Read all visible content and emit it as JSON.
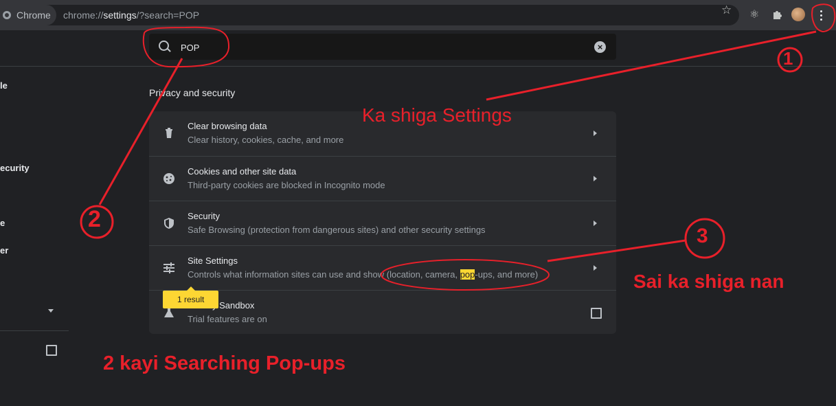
{
  "browser": {
    "tab_label": "Chrome",
    "url_prefix": "chrome://",
    "url_bold": "settings",
    "url_suffix": "/?search=POP"
  },
  "search": {
    "value": "POP",
    "clear_icon": "clear-icon"
  },
  "sidebar": {
    "items": [
      {
        "label": "le"
      },
      {
        "label": "ecurity"
      },
      {
        "label": "e"
      },
      {
        "label": "er"
      }
    ]
  },
  "main": {
    "section_title": "Privacy and security",
    "rows": [
      {
        "icon": "trash-icon",
        "title": "Clear browsing data",
        "subtitle": "Clear history, cookies, cache, and more"
      },
      {
        "icon": "cookie-icon",
        "title": "Cookies and other site data",
        "subtitle": "Third-party cookies are blocked in Incognito mode"
      },
      {
        "icon": "shield-icon",
        "title": "Security",
        "subtitle": "Safe Browsing (protection from dangerous sites) and other security settings"
      },
      {
        "icon": "sliders-icon",
        "title": "Site Settings",
        "subtitle_before": "Controls what information sites can use and show (location, camera, ",
        "subtitle_highlight": "pop",
        "subtitle_after": "-ups, and more)"
      },
      {
        "icon": "flask-icon",
        "title": "Privacy Sandbox",
        "title_visible": "y Sandbox",
        "subtitle": "Trial features are on"
      }
    ],
    "result_bubble": "1 result"
  },
  "annotations": {
    "one": "1",
    "two": "2",
    "three": "3",
    "settings_note": "Ka shiga Settings",
    "search_note": "2 kayi Searching Pop-ups",
    "enter_note": "Sai ka shiga nan",
    "color": "#e8202a"
  }
}
